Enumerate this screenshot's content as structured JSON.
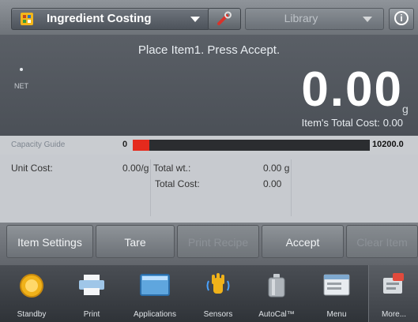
{
  "header": {
    "app_title": "Ingredient Costing",
    "library_label": "Library",
    "info_glyph": "i",
    "icons": [
      "ingredient-costing-icon",
      "wrench-icon",
      "info-icon"
    ]
  },
  "display": {
    "prompt": "Place Item1.  Press Accept.",
    "net_label": "NET",
    "weight": "0.00",
    "unit": "g",
    "item_cost_label": "Item's Total Cost:",
    "item_cost_value": "0.00"
  },
  "capacity": {
    "title": "Capacity Guide",
    "min": "0",
    "max": "10200.0",
    "fill_fraction": 0.07
  },
  "info": {
    "unit_cost_label": "Unit Cost:",
    "unit_cost_value": "0.00/g",
    "total_wt_label": "Total wt.:",
    "total_wt_value": "0.00 g",
    "total_cost_label": "Total Cost:",
    "total_cost_value": "0.00"
  },
  "softkeys": {
    "item_settings": "Item Settings",
    "tare": "Tare",
    "print_recipe": "Print Recipe",
    "accept": "Accept",
    "clear_item": "Clear Item"
  },
  "nav": {
    "standby": "Standby",
    "print": "Print",
    "applications": "Applications",
    "sensors": "Sensors",
    "autocal": "AutoCal™",
    "menu": "Menu",
    "more": "More..."
  },
  "colors": {
    "display_bg": "#50555c",
    "capacity_fill": "#e52a1d",
    "accent_yellow": "#f0b21a"
  }
}
